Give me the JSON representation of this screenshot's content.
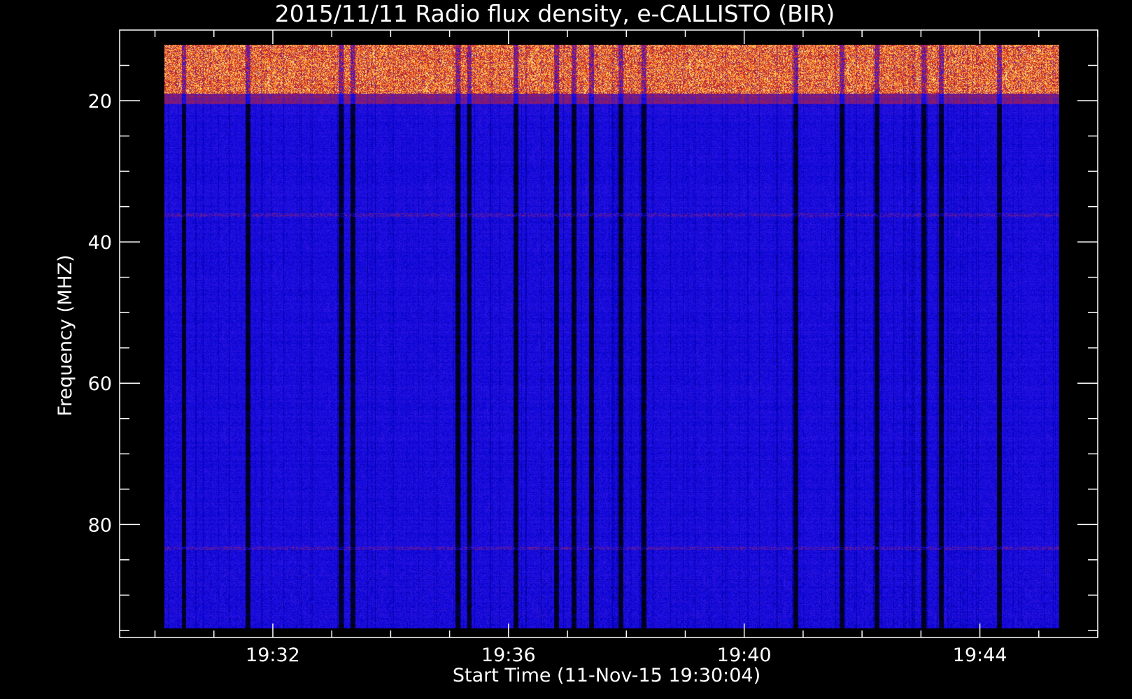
{
  "chart_data": {
    "type": "heatmap",
    "title": "2015/11/11  Radio flux density, e-CALLISTO (BIR)",
    "xlabel": "Start Time (11-Nov-15 19:30:04)",
    "ylabel": "Frequency (MHZ)",
    "x_start_time": "19:30:04",
    "x_range_minutes": [
      29.4,
      46.0
    ],
    "data_x_range_minutes": [
      30.07,
      45.42
    ],
    "y_range_mhz": [
      10.0,
      96.0
    ],
    "data_y_range_mhz": [
      10.5,
      94.5
    ],
    "y_reversed": true,
    "x_major_ticks": [
      {
        "minute": 32,
        "label": "19:32"
      },
      {
        "minute": 36,
        "label": "19:36"
      },
      {
        "minute": 40,
        "label": "19:40"
      },
      {
        "minute": 44,
        "label": "19:44"
      }
    ],
    "x_minor_step_minutes": 1,
    "y_major_ticks": [
      {
        "mhz": 20,
        "label": "20"
      },
      {
        "mhz": 40,
        "label": "40"
      },
      {
        "mhz": 60,
        "label": "60"
      },
      {
        "mhz": 80,
        "label": "80"
      }
    ],
    "y_minor_step_mhz": 5,
    "colormap": [
      "#000000",
      "#0000c8",
      "#2a14e6",
      "#6e1a8a",
      "#d21e1e",
      "#ff8c1e",
      "#fff08c"
    ],
    "features": [
      {
        "name": "intense-rfi-band",
        "mhz_range": [
          10.5,
          17.5
        ],
        "level": "high"
      },
      {
        "name": "moderate-band",
        "mhz_range": [
          17.5,
          19.0
        ],
        "level": "medium"
      },
      {
        "name": "background",
        "mhz_range": [
          19.0,
          94.5
        ],
        "level": "low"
      },
      {
        "name": "narrowband-line",
        "mhz": 35.0,
        "level": "medium"
      },
      {
        "name": "narrowband-line",
        "mhz": 83.0,
        "level": "medium"
      },
      {
        "name": "dark-vertical-stripes",
        "minutes": [
          30.4,
          31.5,
          33.1,
          33.3,
          35.1,
          35.3,
          36.1,
          36.8,
          37.1,
          37.4,
          37.9,
          38.3,
          40.9,
          41.7,
          42.3,
          43.1,
          43.4,
          44.4
        ],
        "level": "dark"
      }
    ]
  }
}
